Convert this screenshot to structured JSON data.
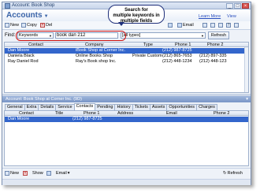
{
  "window": {
    "title": "Account: Book Shop"
  },
  "header": {
    "title": "Accounts",
    "learn_more": "Learn More",
    "view": "View"
  },
  "callout": {
    "line1": "Search for",
    "line2": "multiple keywords in",
    "line3": "multiple fields"
  },
  "toolbar": {
    "new": "New",
    "copy": "Copy",
    "delete": "Del",
    "email": "Email"
  },
  "find": {
    "label": "Find:",
    "field": "Keywords",
    "value": "book dan 212",
    "types": "[all types]",
    "refresh": "Refresh"
  },
  "grid": {
    "columns": [
      "Contact",
      "Company",
      "Type",
      "Phone 1",
      "Phone 2"
    ],
    "rows": [
      [
        "Dan Moore",
        "iBook Shop at Corner Inc.",
        "",
        "(212) 987-8725",
        ""
      ],
      [
        "Daniela Black",
        "Online Books Shop",
        "Private Customer",
        "(212) 865-7653",
        "(212) 897-335"
      ],
      [
        "Ray Daniel Rod",
        "Ray's Book shop Inc.",
        "",
        "(212) 448-1234",
        "(212) 448-123"
      ]
    ]
  },
  "subpanel": {
    "title": "Account: Book Shop at Corner Inc. (9D)"
  },
  "tabs": [
    "General",
    "Extra",
    "Details",
    "Service",
    "Contacts",
    "Pending",
    "History",
    "Tickets",
    "Assets",
    "Opportunities",
    "Charges"
  ],
  "active_tab": "Contacts",
  "grid2": {
    "columns": [
      "Contact",
      "Title",
      "Phone 1",
      "Address",
      "Email",
      "Phone 2"
    ],
    "rows": [
      [
        "Dan Moore",
        "",
        "(212) 987-8725",
        "",
        "",
        ""
      ]
    ]
  },
  "bottom": {
    "new": "New",
    "show": "Show",
    "email": "Email",
    "refresh": "Refresh"
  }
}
